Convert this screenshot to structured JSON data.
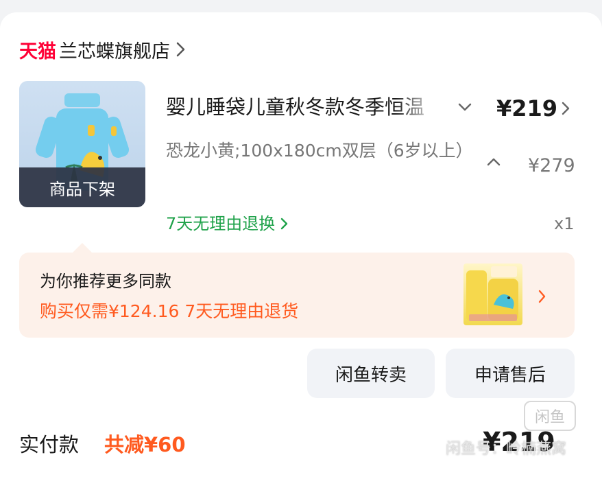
{
  "store": {
    "brand": "天猫",
    "name": "兰芯蝶旗舰店"
  },
  "item": {
    "title": "婴儿睡袋儿童秋冬款冬季恒温",
    "status_overlay": "商品下架",
    "price": "¥219",
    "variant": "恐龙小黄;100x180cm双层（6岁以上）",
    "original_price": "¥279",
    "return_policy": "7天无理由退换",
    "quantity": "x1"
  },
  "recommend": {
    "title": "为你推荐更多同款",
    "subtitle": "购买仅需¥124.16 7天无理由退货"
  },
  "actions": {
    "resell": "闲鱼转卖",
    "after_sales": "申请售后"
  },
  "summary": {
    "paid_label": "实付款",
    "discount": "共减¥60",
    "paid_amount": "¥219"
  },
  "watermark": {
    "logo": "闲鱼",
    "text": "闲鱼号：岭楠燕窝"
  },
  "colors": {
    "tmall_red": "#ff0036",
    "accent_orange": "#ff5a1f",
    "return_green": "#1fa24a",
    "rec_bg": "#fdf1ea"
  },
  "icons": [
    "chevron-right-icon",
    "chevron-down-icon",
    "chevron-up-icon"
  ]
}
